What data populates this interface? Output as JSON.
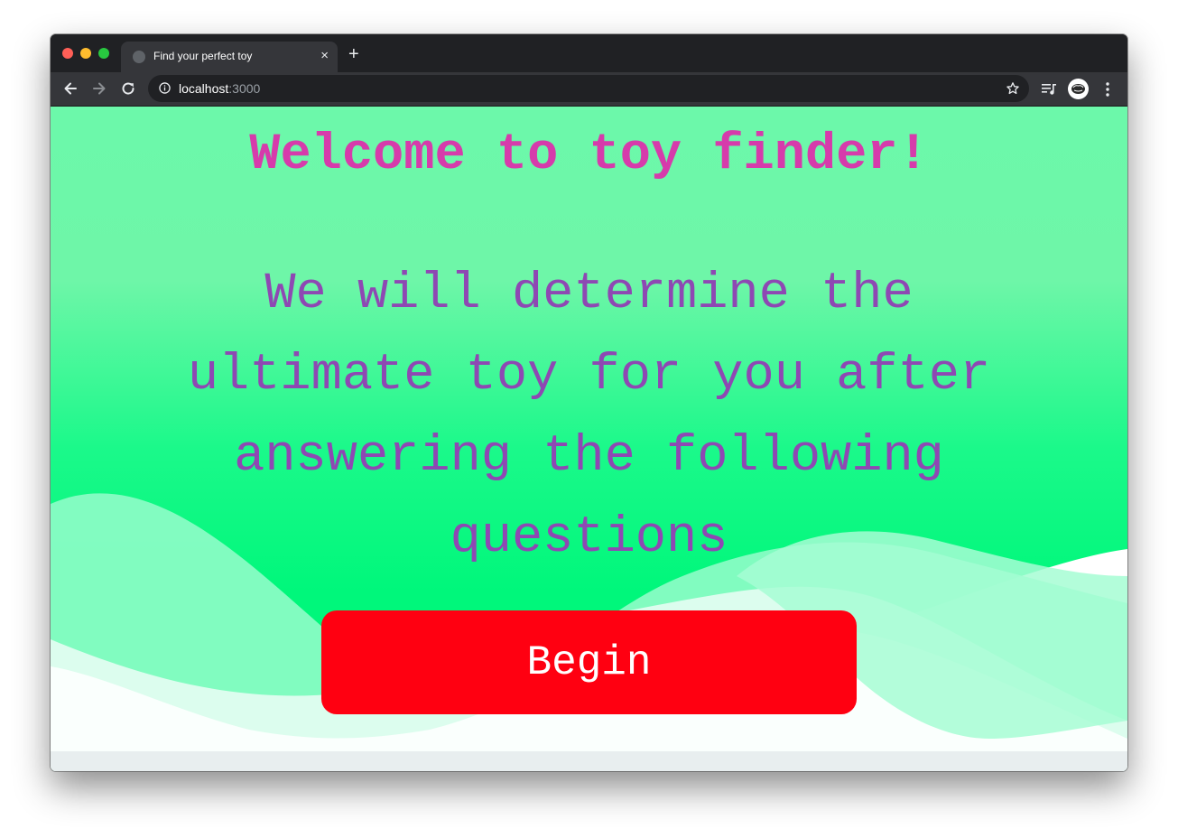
{
  "browser": {
    "tab_title": "Find your perfect toy",
    "tab_close_glyph": "×",
    "new_tab_glyph": "+",
    "url_host": "localhost",
    "url_port": ":3000"
  },
  "page": {
    "heading": "Welcome to toy finder!",
    "intro": "We will determine the ultimate toy for you after answering the following questions",
    "begin_label": "Begin"
  },
  "colors": {
    "heading": "#d63bab",
    "intro": "#8e48b3",
    "button": "#ff0011",
    "background_top": "#6ef9a8",
    "background_mid": "#00f77b"
  },
  "icons": {
    "back": "arrow-left-icon",
    "forward": "arrow-right-icon",
    "reload": "reload-icon",
    "site_info": "info-icon",
    "bookmark": "star-icon",
    "media": "media-playlist-icon",
    "profile": "avatar-icon",
    "menu": "kebab-menu-icon"
  }
}
